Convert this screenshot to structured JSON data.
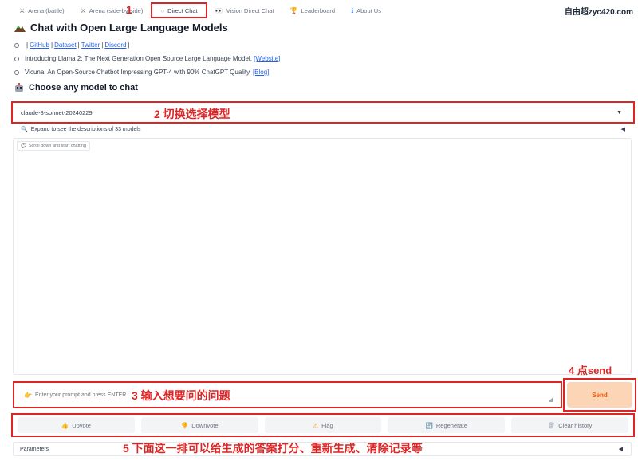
{
  "tabs": [
    {
      "label": "Arena (battle)",
      "icon": "crossed-swords-icon"
    },
    {
      "label": "Arena (side-by-side)",
      "icon": "crossed-swords-icon"
    },
    {
      "label": "Direct Chat",
      "icon": "chat-bubble-icon"
    },
    {
      "label": "Vision Direct Chat",
      "icon": "eyes-icon"
    },
    {
      "label": "Leaderboard",
      "icon": "trophy-icon"
    },
    {
      "label": "About Us",
      "icon": "info-icon"
    }
  ],
  "watermark": "自由超zyc420.com",
  "title": "Chat with Open Large Language Models",
  "links": {
    "github": "GitHub",
    "dataset": "Dataset",
    "twitter": "Twitter",
    "discord": "Discord"
  },
  "news": [
    {
      "text": "Introducing Llama 2: The Next Generation Open Source Large Language Model.",
      "link": "[Website]"
    },
    {
      "text": "Vicuna: An Open-Source Chatbot Impressing GPT-4 with 90% ChatGPT Quality.",
      "link": "[Blog]"
    }
  ],
  "choose_heading": "Choose any model to chat",
  "model_select": {
    "value": "claude-3-sonnet-20240229"
  },
  "expand_label": "Expand to see the descriptions of 33 models",
  "chat_label": "Scroll down and start chatting",
  "prompt": {
    "placeholder": "Enter your prompt and press ENTER"
  },
  "send_label": "Send",
  "actions": {
    "upvote": "Upvote",
    "downvote": "Downvote",
    "flag": "Flag",
    "regenerate": "Regenerate",
    "clear": "Clear history"
  },
  "parameters_label": "Parameters",
  "annotations": {
    "a1": "1",
    "a2": "2 切换选择模型",
    "a3": "3 输入想要问的问题",
    "a4": "4 点send",
    "a5": "5 下面这一排可以给生成的答案打分、重新生成、清除记录等"
  },
  "colors": {
    "highlight": "#dc2626",
    "send_bg": "#fbd5b5",
    "send_text": "#ea580c",
    "link": "#2563eb"
  }
}
